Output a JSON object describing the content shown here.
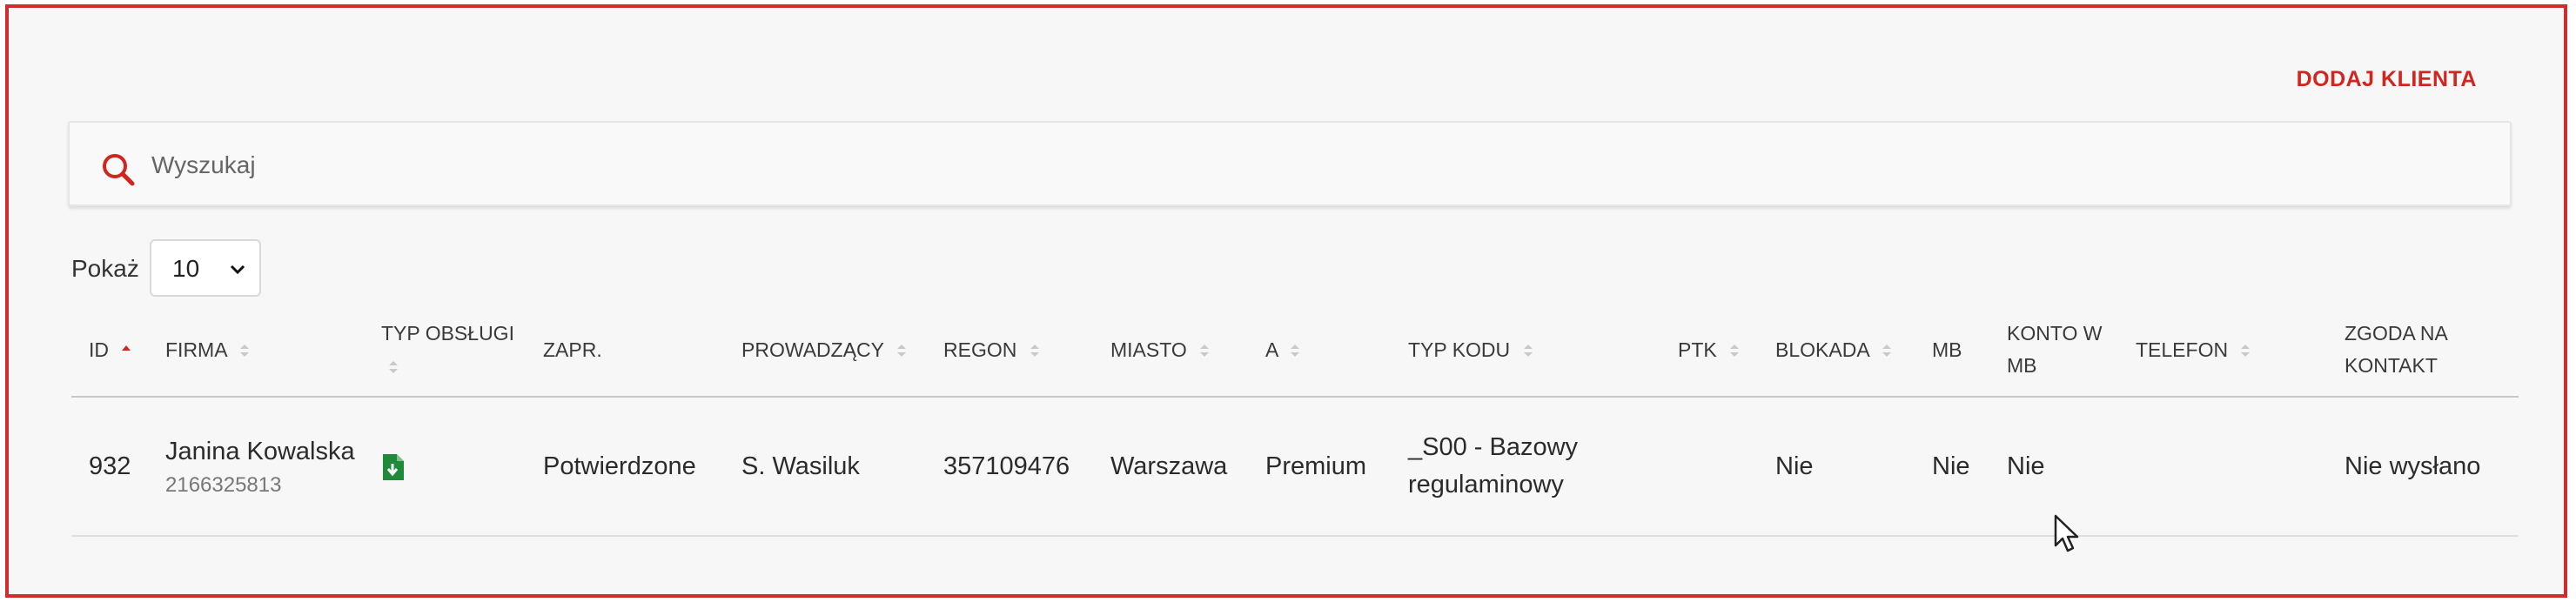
{
  "actions": {
    "add_client": "DODAJ KLIENTA"
  },
  "search": {
    "placeholder": "Wyszukaj",
    "icon": "search-icon"
  },
  "page_size": {
    "label": "Pokaż",
    "selected": "10"
  },
  "table": {
    "headers": {
      "id": "ID",
      "firma": "FIRMA",
      "typ_obslugi": "TYP OBSŁUGI",
      "zapr": "ZAPR.",
      "prowadzacy": "PROWADZĄCY",
      "regon": "REGON",
      "miasto": "MIASTO",
      "a": "A",
      "typ_kodu": "TYP KODU",
      "ptk": "PTK",
      "blokada": "BLOKADA",
      "mb": "MB",
      "konto_w_mb": "KONTO W MB",
      "telefon": "TELEFON",
      "zgoda": "ZGODA NA KONTAKT"
    },
    "rows": [
      {
        "id": "932",
        "firma_name": "Janina Kowalska",
        "firma_phone": "2166325813",
        "typ_obslugi_icon": "document-download-icon",
        "zapr": "Potwierdzone",
        "prowadzacy": "S. Wasiluk",
        "regon": "357109476",
        "miasto": "Warszawa",
        "a": "Premium",
        "typ_kodu": "_S00 - Bazowy regulaminowy",
        "ptk": "",
        "blokada": "Nie",
        "mb": "Nie",
        "konto_w_mb": "Nie",
        "telefon": "",
        "zgoda": "Nie wysłano"
      }
    ]
  },
  "colors": {
    "accent": "#d1261f",
    "frame_border": "#d12b2b",
    "icon_green": "#1f8a3a",
    "sort_active": "#d1261f",
    "sort_inactive": "#c9c9c9"
  }
}
